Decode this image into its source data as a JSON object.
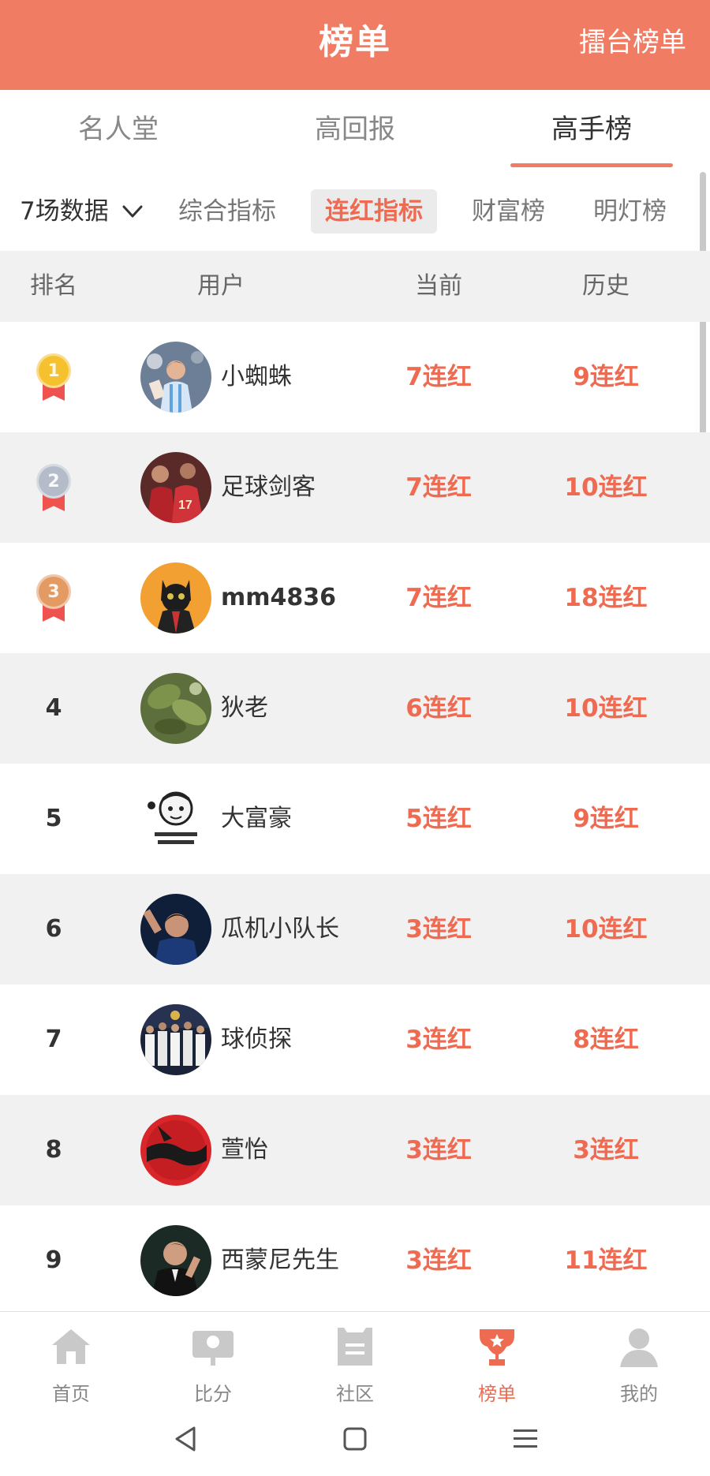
{
  "header": {
    "title": "榜单",
    "right_link": "擂台榜单"
  },
  "main_tabs": [
    {
      "label": "名人堂"
    },
    {
      "label": "高回报"
    },
    {
      "label": "高手榜"
    }
  ],
  "filters": {
    "period": "7场数据",
    "items": [
      {
        "label": "综合指标"
      },
      {
        "label": "连红指标"
      },
      {
        "label": "财富榜"
      },
      {
        "label": "明灯榜"
      }
    ],
    "active": "连红指标"
  },
  "table": {
    "headers": {
      "rank": "排名",
      "user": "用户",
      "current": "当前",
      "history": "历史"
    },
    "rows": [
      {
        "rank": "1",
        "medal": "gold",
        "name": "小蜘蛛",
        "current": "7连红",
        "history": "9连红"
      },
      {
        "rank": "2",
        "medal": "silver",
        "name": "足球剑客",
        "current": "7连红",
        "history": "10连红"
      },
      {
        "rank": "3",
        "medal": "bronze",
        "name": "mm4836",
        "current": "7连红",
        "history": "18连红"
      },
      {
        "rank": "4",
        "name": "狄老",
        "current": "6连红",
        "history": "10连红"
      },
      {
        "rank": "5",
        "name": "大富豪",
        "current": "5连红",
        "history": "9连红"
      },
      {
        "rank": "6",
        "name": "瓜机小队长",
        "current": "3连红",
        "history": "10连红"
      },
      {
        "rank": "7",
        "name": "球侦探",
        "current": "3连红",
        "history": "8连红"
      },
      {
        "rank": "8",
        "name": "萱怡",
        "current": "3连红",
        "history": "3连红"
      },
      {
        "rank": "9",
        "name": "西蒙尼先生",
        "current": "3连红",
        "history": "11连红"
      }
    ]
  },
  "bottom_nav": [
    {
      "label": "首页",
      "icon": "home-icon"
    },
    {
      "label": "比分",
      "icon": "score-icon"
    },
    {
      "label": "社区",
      "icon": "community-icon"
    },
    {
      "label": "榜单",
      "icon": "trophy-icon",
      "active": true
    },
    {
      "label": "我的",
      "icon": "profile-icon"
    }
  ],
  "colors": {
    "accent": "#f07c63",
    "highlight_text": "#ee6b52",
    "row_alt": "#f1f1f1"
  }
}
